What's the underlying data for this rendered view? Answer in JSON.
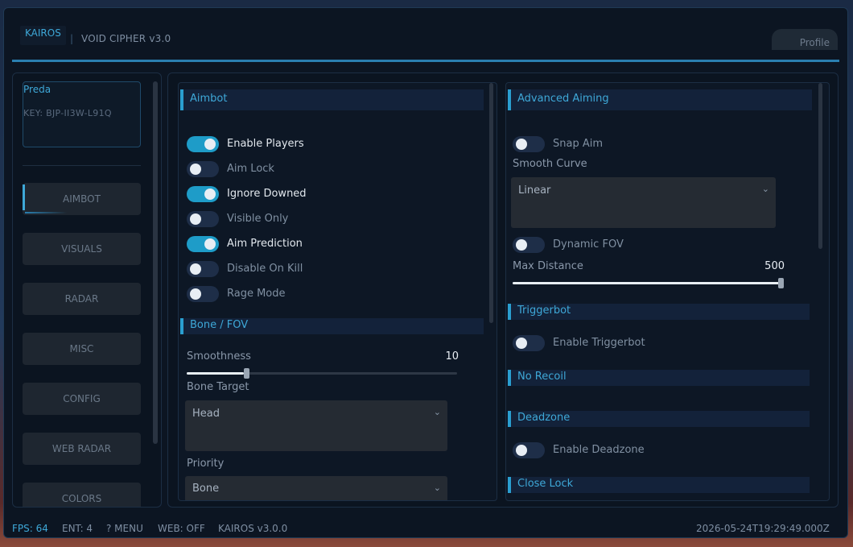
{
  "header": {
    "brand": "KAIROS",
    "separator": "|",
    "subtitle": "VOID CIPHER  v3.0",
    "profile_label": "Profile"
  },
  "user": {
    "name": "Preda",
    "key": "KEY: BJP-II3W-L91Q"
  },
  "nav": {
    "items": [
      {
        "label": "AIMBOT",
        "active": true
      },
      {
        "label": "VISUALS"
      },
      {
        "label": "RADAR"
      },
      {
        "label": "MISC"
      },
      {
        "label": "CONFIG"
      },
      {
        "label": "WEB RADAR"
      },
      {
        "label": "COLORS"
      }
    ]
  },
  "aimbot": {
    "title": "Aimbot",
    "toggles": [
      {
        "label": "Enable Players",
        "on": true
      },
      {
        "label": "Aim Lock",
        "on": false
      },
      {
        "label": "Ignore Downed",
        "on": true
      },
      {
        "label": "Visible Only",
        "on": false
      },
      {
        "label": "Aim Prediction",
        "on": true
      },
      {
        "label": "Disable On Kill",
        "on": false
      },
      {
        "label": "Rage Mode",
        "on": false
      }
    ]
  },
  "bone_fov": {
    "title": "Bone / FOV",
    "smoothness_label": "Smoothness",
    "smoothness_value": "10",
    "smoothness_fraction": 0.21,
    "bone_target_label": "Bone Target",
    "bone_target_value": "Head",
    "priority_label": "Priority",
    "priority_value": "Bone"
  },
  "advanced": {
    "title": "Advanced Aiming",
    "snap_aim_label": "Snap Aim",
    "snap_aim_on": false,
    "smooth_curve_label": "Smooth Curve",
    "smooth_curve_value": "Linear",
    "dynamic_fov_label": "Dynamic FOV",
    "dynamic_fov_on": false,
    "max_distance_label": "Max Distance",
    "max_distance_value": "500",
    "max_distance_fraction": 1.0
  },
  "triggerbot": {
    "title": "Triggerbot",
    "enable_label": "Enable Triggerbot",
    "enable_on": false
  },
  "no_recoil": {
    "title": "No Recoil"
  },
  "deadzone": {
    "title": "Deadzone",
    "enable_label": "Enable Deadzone",
    "enable_on": false
  },
  "close_lock": {
    "title": "Close Lock"
  },
  "status": {
    "fps": "FPS: 64",
    "ent": "ENT: 4",
    "menu": "? MENU",
    "web": "WEB: OFF",
    "version": "KAIROS v3.0.0",
    "timestamp": "2026-05-24T19:29:49.000Z"
  },
  "colors": {
    "accent": "#3ea8d8",
    "toggle_on": "#1e9cc8",
    "background": "#0c1522"
  }
}
